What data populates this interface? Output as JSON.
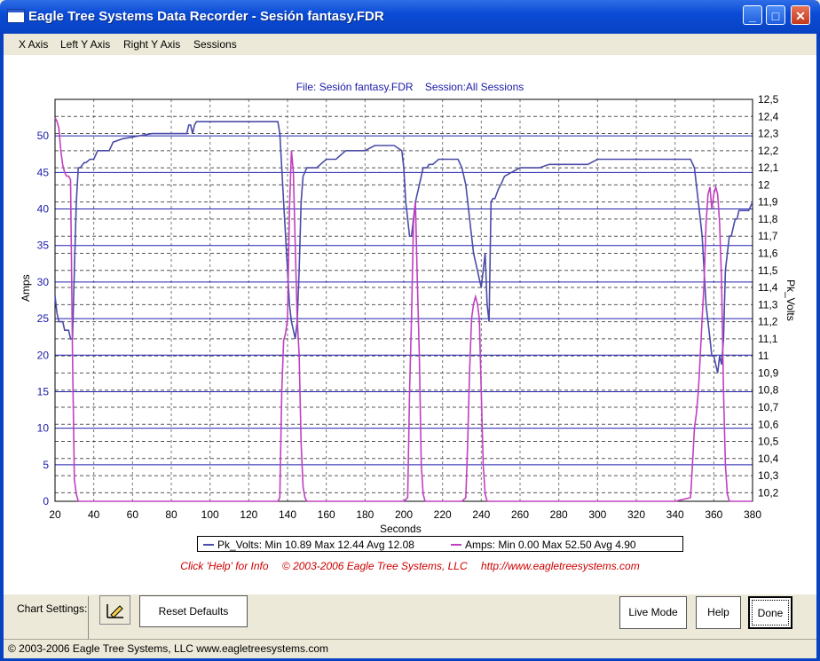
{
  "window": {
    "title": "Eagle Tree Systems Data Recorder - Sesión fantasy.FDR"
  },
  "menu": [
    "X Axis",
    "Left Y Axis",
    "Right Y Axis",
    "Sessions"
  ],
  "chart_header": {
    "file": "File: Sesión fantasy.FDR",
    "session": "Session:All Sessions"
  },
  "chart_data": {
    "type": "line",
    "xlabel": "Seconds",
    "ylabel_left": "Amps",
    "ylabel_right": "Pk_Volts",
    "xlim": [
      20,
      380
    ],
    "ylim_left": [
      0,
      55
    ],
    "ylim_right": [
      10.15,
      12.5
    ],
    "x_ticks": [
      20,
      40,
      60,
      80,
      100,
      120,
      140,
      160,
      180,
      200,
      220,
      240,
      260,
      280,
      300,
      320,
      340,
      360,
      380
    ],
    "y_left_ticks": [
      0,
      5,
      10,
      15,
      20,
      25,
      30,
      35,
      40,
      45,
      50
    ],
    "y_right_ticks": [
      "10,2",
      "10,3",
      "10,4",
      "10,5",
      "10,6",
      "10,7",
      "10,8",
      "10,9",
      "11",
      "11,1",
      "11,2",
      "11,3",
      "11,4",
      "11,5",
      "11,6",
      "11,7",
      "11,8",
      "11,9",
      "12",
      "12,1",
      "12,2",
      "12,3",
      "12,4",
      "12,5"
    ],
    "grid": true,
    "series": [
      {
        "name": "Pk_Volts",
        "axis": "right",
        "color": "#4b4ba8",
        "x": [
          20,
          21,
          22,
          23,
          24,
          25,
          26,
          27,
          28,
          29,
          30,
          31,
          32,
          33,
          35,
          36,
          38,
          40,
          42,
          48,
          50,
          55,
          60,
          70,
          80,
          88,
          89,
          90,
          91,
          92,
          93,
          95,
          100,
          110,
          120,
          130,
          135,
          136,
          137,
          138,
          139,
          140,
          141,
          142,
          143,
          144,
          145,
          146,
          147,
          148,
          150,
          155,
          160,
          165,
          170,
          175,
          180,
          185,
          190,
          195,
          199,
          200,
          201,
          202,
          203,
          204,
          205,
          206,
          207,
          208,
          209,
          210,
          211,
          212,
          213,
          215,
          218,
          220,
          222,
          225,
          228,
          230,
          232,
          234,
          235,
          236,
          237,
          238,
          239,
          240,
          241,
          242,
          243,
          244,
          245,
          246,
          247,
          248,
          249,
          250,
          252,
          255,
          260,
          265,
          270,
          275,
          280,
          285,
          290,
          295,
          300,
          310,
          320,
          330,
          340,
          345,
          348,
          350,
          351,
          352,
          353,
          354,
          355,
          356,
          357,
          358,
          359,
          360,
          361,
          362,
          363,
          364,
          365,
          366,
          367,
          368,
          369,
          370,
          371,
          372,
          373,
          375,
          378,
          380
        ],
        "y": [
          11.35,
          11.25,
          11.2,
          11.2,
          11.2,
          11.15,
          11.15,
          11.15,
          11.1,
          11.1,
          11.5,
          11.9,
          12.1,
          12.1,
          12.13,
          12.13,
          12.15,
          12.15,
          12.2,
          12.2,
          12.25,
          12.27,
          12.28,
          12.3,
          12.3,
          12.3,
          12.35,
          12.35,
          12.3,
          12.35,
          12.37,
          12.37,
          12.37,
          12.37,
          12.37,
          12.37,
          12.37,
          12.3,
          12.1,
          11.9,
          11.7,
          11.5,
          11.3,
          11.2,
          11.15,
          11.1,
          11.2,
          11.5,
          11.9,
          12.05,
          12.1,
          12.1,
          12.15,
          12.15,
          12.2,
          12.2,
          12.2,
          12.23,
          12.23,
          12.23,
          12.2,
          12.1,
          11.9,
          11.8,
          11.7,
          11.7,
          11.8,
          11.9,
          11.95,
          12.0,
          12.05,
          12.1,
          12.1,
          12.1,
          12.12,
          12.12,
          12.15,
          12.15,
          12.15,
          12.15,
          12.15,
          12.1,
          12.0,
          11.8,
          11.7,
          11.6,
          11.55,
          11.5,
          11.45,
          11.4,
          11.5,
          11.6,
          11.3,
          11.2,
          11.9,
          11.92,
          11.92,
          11.95,
          11.98,
          12.0,
          12.05,
          12.07,
          12.1,
          12.1,
          12.1,
          12.12,
          12.12,
          12.12,
          12.12,
          12.12,
          12.15,
          12.15,
          12.15,
          12.15,
          12.15,
          12.15,
          12.15,
          12.1,
          12.0,
          11.9,
          11.8,
          11.7,
          11.5,
          11.3,
          11.2,
          11.1,
          11.0,
          11.0,
          10.95,
          10.9,
          11.0,
          10.95,
          11.1,
          11.5,
          11.6,
          11.7,
          11.7,
          11.75,
          11.8,
          11.8,
          11.85,
          11.85,
          11.85,
          11.9
        ]
      },
      {
        "name": "Amps",
        "axis": "left",
        "color": "#c040c0",
        "x": [
          20,
          21,
          22,
          23,
          24,
          25,
          26,
          27,
          28,
          29,
          30,
          31,
          32,
          35,
          40,
          60,
          80,
          100,
          120,
          130,
          135,
          136,
          137,
          138,
          139,
          140,
          141,
          142,
          143,
          144,
          145,
          146,
          147,
          148,
          149,
          150,
          152,
          160,
          180,
          200,
          202,
          203,
          204,
          205,
          206,
          207,
          208,
          209,
          210,
          211,
          212,
          213,
          215,
          220,
          230,
          232,
          233,
          234,
          235,
          236,
          237,
          238,
          239,
          240,
          241,
          242,
          243,
          244,
          245,
          246,
          247,
          248,
          250,
          260,
          280,
          300,
          320,
          340,
          348,
          349,
          350,
          351,
          352,
          353,
          354,
          355,
          356,
          357,
          358,
          359,
          360,
          361,
          362,
          363,
          364,
          365,
          366,
          367,
          368,
          369,
          370,
          371,
          372,
          375,
          380
        ],
        "y": [
          52.5,
          52.0,
          51.0,
          48.0,
          46.0,
          45.0,
          44.5,
          44.5,
          44.0,
          20.0,
          3.0,
          1.0,
          0.0,
          0.0,
          0.0,
          0.0,
          0.0,
          0.0,
          0.0,
          0.0,
          0.0,
          0.5,
          15.0,
          22.0,
          23.0,
          25.0,
          40.0,
          48.0,
          45.0,
          35.0,
          25.0,
          20.0,
          8.0,
          2.0,
          0.5,
          0.0,
          0.0,
          0.0,
          0.0,
          0.0,
          0.5,
          15.0,
          25.0,
          38.0,
          41.0,
          30.0,
          20.0,
          5.0,
          1.0,
          0.0,
          0.0,
          0.0,
          0.0,
          0.0,
          0.0,
          0.5,
          8.0,
          18.0,
          25.0,
          27.0,
          28.0,
          27.0,
          25.0,
          15.0,
          5.0,
          1.0,
          0.0,
          0.0,
          0.0,
          0.0,
          0.0,
          0.0,
          0.0,
          0.0,
          0.0,
          0.0,
          0.0,
          0.0,
          0.5,
          5.0,
          10.0,
          12.0,
          15.0,
          20.0,
          25.0,
          30.0,
          38.0,
          42.0,
          43.0,
          40.0,
          42.0,
          43.0,
          42.0,
          38.0,
          30.0,
          15.0,
          5.0,
          1.0,
          0.0,
          0.0,
          0.0,
          0.0,
          0.0,
          0.0,
          0.0
        ]
      }
    ]
  },
  "legend": {
    "volts": "Pk_Volts:  Min 10.89 Max 12.44 Avg 12.08",
    "amps": "Amps:  Min 0.00 Max 52.50 Avg 4.90"
  },
  "credits": {
    "help": "Click 'Help' for Info",
    "copyright": "© 2003-2006 Eagle Tree Systems, LLC",
    "url": "http://www.eagletreesystems.com"
  },
  "bottom": {
    "chart_settings": "Chart Settings:",
    "reset": "Reset Defaults",
    "live": "Live Mode",
    "help": "Help",
    "done": "Done"
  },
  "status": "© 2003-2006 Eagle Tree Systems, LLC      www.eagletreesystems.com"
}
